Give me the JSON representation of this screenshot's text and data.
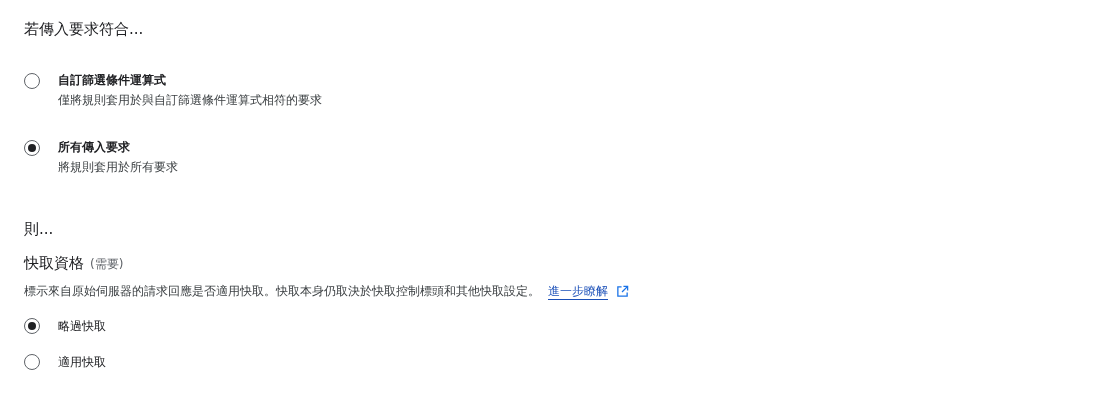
{
  "match_heading": "若傳入要求符合...",
  "match_options": [
    {
      "label": "自訂篩選條件運算式",
      "description": "僅將規則套用於與自訂篩選條件運算式相符的要求",
      "selected": false
    },
    {
      "label": "所有傳入要求",
      "description": "將規則套用於所有要求",
      "selected": true
    }
  ],
  "then_heading": "則...",
  "cache_eligibility": {
    "title": "快取資格",
    "required_note": "(需要)",
    "description": "標示來自原始伺服器的請求回應是否適用快取。快取本身仍取決於快取控制標頭和其他快取設定。",
    "link": "進一步瞭解",
    "options": [
      {
        "label": "略過快取",
        "selected": true
      },
      {
        "label": "適用快取",
        "selected": false
      }
    ]
  }
}
